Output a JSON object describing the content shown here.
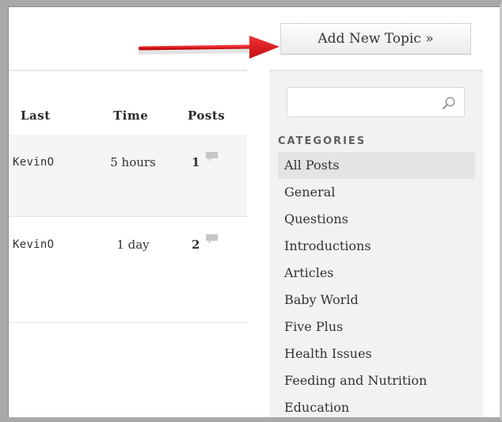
{
  "toolbar": {
    "add_topic_label": "Add New Topic »"
  },
  "table": {
    "headers": {
      "last": "Last",
      "time": "Time",
      "posts": "Posts"
    },
    "rows": [
      {
        "last": "KevinO",
        "time": "5 hours",
        "posts": "1"
      },
      {
        "last": "KevinO",
        "time": "1 day",
        "posts": "2"
      }
    ]
  },
  "sidebar": {
    "search": {
      "value": "",
      "placeholder": ""
    },
    "categories_heading": "CATEGORIES",
    "categories": [
      "All Posts",
      "General",
      "Questions",
      "Introductions",
      "Articles",
      "Baby World",
      "Five Plus",
      "Health Issues",
      "Feeding and Nutrition",
      "Education"
    ],
    "active_category": "All Posts"
  },
  "colors": {
    "arrow": "#e3151a",
    "frame": "#a9a9a9",
    "sidebar_bg": "#f2f2f2",
    "active_row_bg": "#e4e4e4",
    "icon_gray": "#c6c6c6"
  },
  "icons": {
    "search": "magnifier-icon",
    "posts": "speech-bubble-icon",
    "pointer": "red-arrow"
  }
}
